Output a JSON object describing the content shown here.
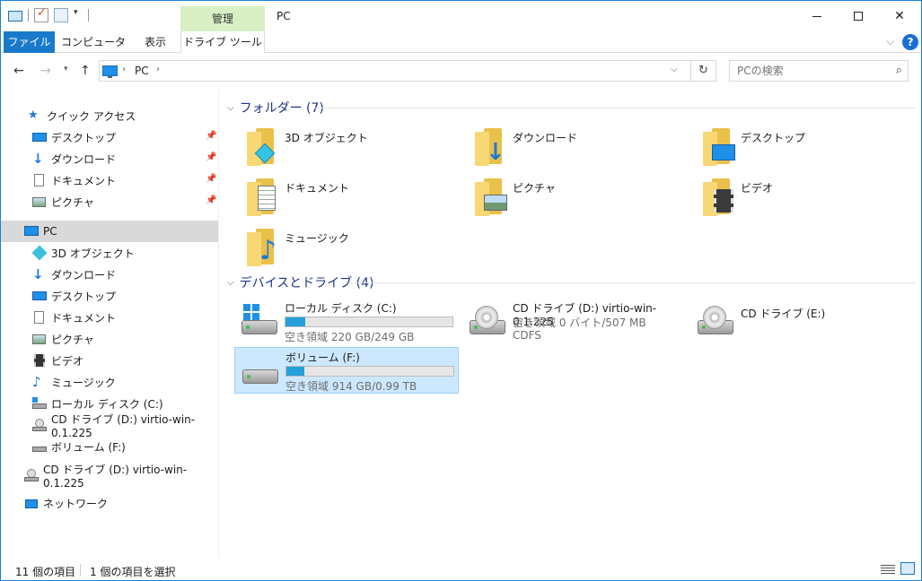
{
  "window": {
    "title": "PC"
  },
  "ribbon": {
    "context_group": "管理",
    "tabs": {
      "file": "ファイル",
      "computer": "コンピューター",
      "view": "表示",
      "drive_tools": "ドライブ ツール"
    }
  },
  "address": {
    "path": "PC",
    "search_placeholder": "PCの検索"
  },
  "navpane": {
    "quick_access": "クイック アクセス",
    "quick_items": [
      "デスクトップ",
      "ダウンロード",
      "ドキュメント",
      "ピクチャ"
    ],
    "pc": "PC",
    "pc_items": [
      "3D オブジェクト",
      "ダウンロード",
      "デスクトップ",
      "ドキュメント",
      "ピクチャ",
      "ビデオ",
      "ミュージック",
      "ローカル ディスク (C:)",
      "CD ドライブ (D:) virtio-win-0.1.225",
      "ボリューム (F:)"
    ],
    "cd_root": "CD ドライブ (D:) virtio-win-0.1.225",
    "network": "ネットワーク"
  },
  "content": {
    "folders_header": "フォルダー (7)",
    "folders": [
      "3D オブジェクト",
      "ダウンロード",
      "デスクトップ",
      "ドキュメント",
      "ピクチャ",
      "ビデオ",
      "ミュージック"
    ],
    "devices_header": "デバイスとドライブ (4)",
    "drives": [
      {
        "name": "ローカル ディスク (C:)",
        "free": "空き領域 220 GB/249 GB",
        "used_fraction": 0.12
      },
      {
        "name": "CD ドライブ (D:) virtio-win-0.1.225",
        "free": "空き領域 0 バイト/507 MB",
        "fs": "CDFS"
      },
      {
        "name": "CD ドライブ (E:)"
      },
      {
        "name": "ボリューム (F:)",
        "free": "空き領域 914 GB/0.99 TB",
        "used_fraction": 0.11
      }
    ]
  },
  "status": {
    "count": "11 個の項目",
    "selection": "1 個の項目を選択"
  },
  "colors": {
    "accent": "#1979ca",
    "bar_fill": "#26a0da",
    "selection": "#cce8ff",
    "header_text": "#1e3287"
  }
}
